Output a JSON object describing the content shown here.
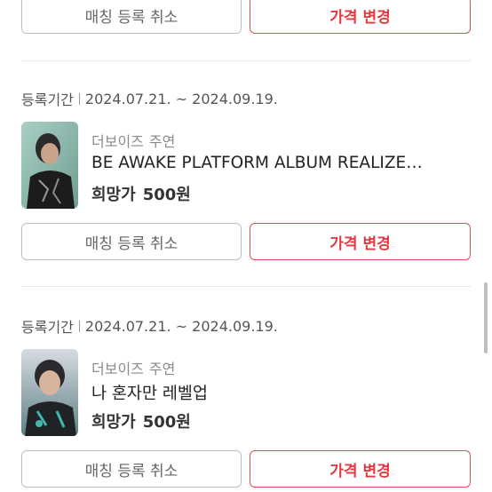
{
  "top_card": {
    "cancel_label": "매칭 등록 취소",
    "change_price_label": "가격 변경"
  },
  "items": [
    {
      "period_label": "등록기간",
      "period": "2024.07.21. ~ 2024.09.19.",
      "artist": "더보이즈",
      "role": "주연",
      "title": "BE AWAKE PLATFORM ALBUM REALIZE…",
      "price_label": "희망가",
      "price": "500원",
      "cancel_label": "매칭 등록 취소",
      "change_price_label": "가격 변경"
    },
    {
      "period_label": "등록기간",
      "period": "2024.07.21. ~ 2024.09.19.",
      "artist": "더보이즈",
      "role": "주연",
      "title": "나 혼자만 레벨업",
      "price_label": "희망가",
      "price": "500원",
      "cancel_label": "매칭 등록 취소",
      "change_price_label": "가격 변경"
    }
  ],
  "colors": {
    "accent": "#e03a40",
    "muted": "#8a8a8a"
  }
}
